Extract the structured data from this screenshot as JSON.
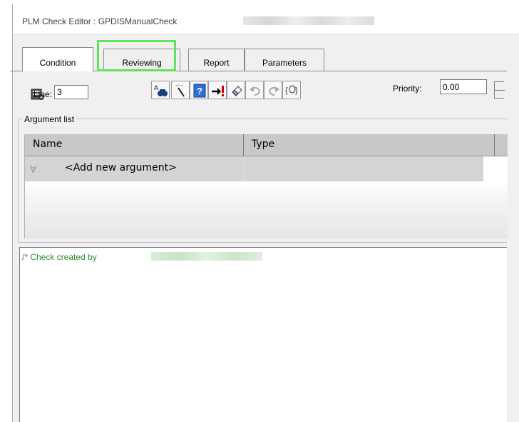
{
  "window": {
    "title": "PLM Check Editor : GPDISManualCheck"
  },
  "tabs": [
    {
      "label": "Condition",
      "active": true
    },
    {
      "label": "Reviewing",
      "active": false,
      "highlighted": true
    },
    {
      "label": "Report",
      "active": false
    },
    {
      "label": "Parameters",
      "active": false
    }
  ],
  "toolbar": {
    "line_label": "Line:",
    "line_value": "3",
    "priority_label": "Priority:",
    "priority_value": "0.00",
    "buttons": [
      "settings-icon",
      "find-icon",
      "magic-wand-icon",
      "help-icon",
      "goto-error-icon",
      "eraser-icon",
      "undo-icon",
      "redo-icon",
      "expand-code-icon"
    ]
  },
  "argument_list": {
    "legend": "Argument list",
    "columns": [
      "Name",
      "Type"
    ],
    "new_row_text": "<Add new argument>"
  },
  "editor": {
    "comment": "/* Check created by"
  },
  "colors": {
    "highlight": "#5fe35a",
    "comment": "#2e8b2e",
    "header_bg": "#c8c8c8"
  }
}
